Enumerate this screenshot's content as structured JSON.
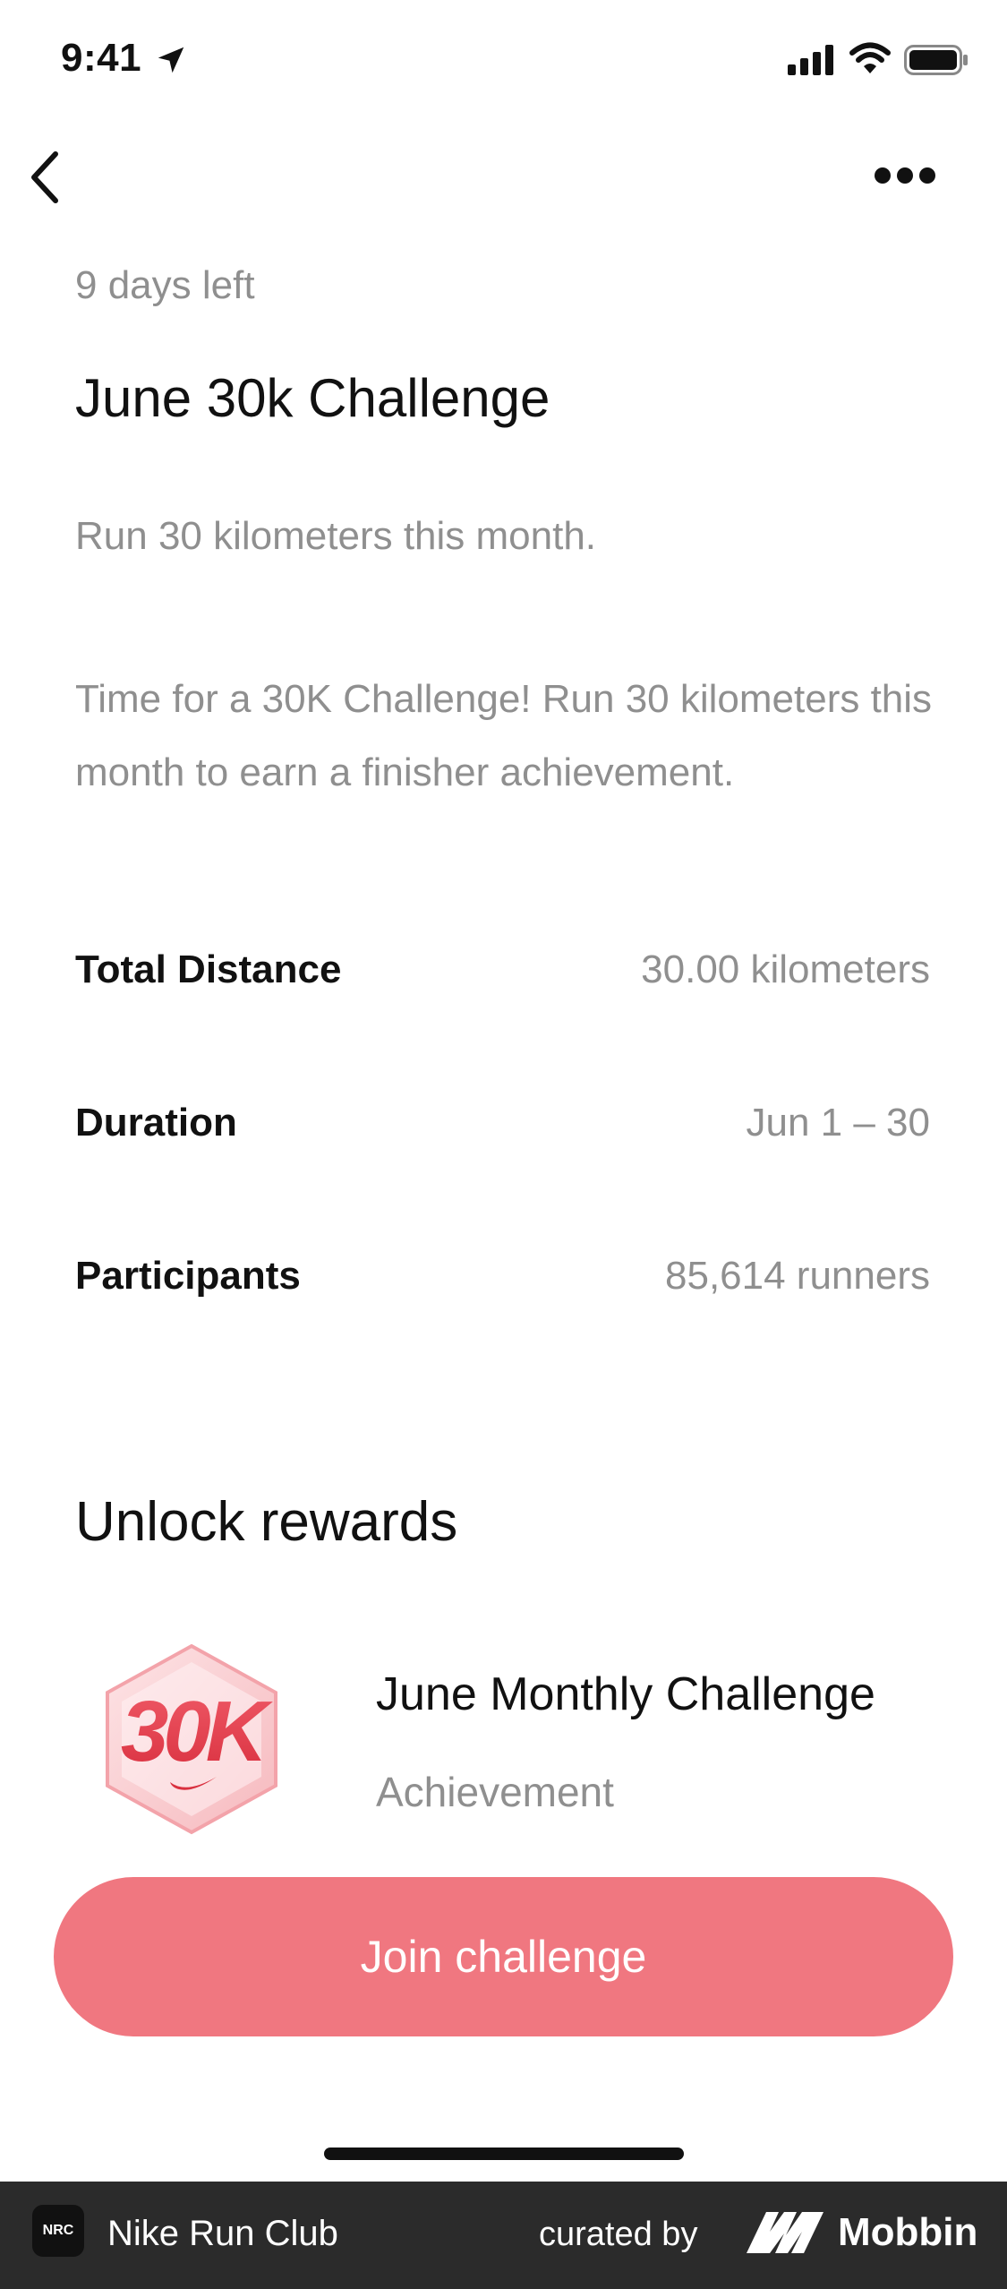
{
  "status_bar": {
    "time": "9:41"
  },
  "header": {
    "days_left": "9 days left",
    "title": "June 30k Challenge"
  },
  "intro": {
    "subtitle": "Run 30 kilometers this month.",
    "description": "Time for a 30K Challenge! Run 30 kilometers this month to earn a finisher achievement."
  },
  "details": [
    {
      "label": "Total Distance",
      "value": "30.00 kilometers"
    },
    {
      "label": "Duration",
      "value": "Jun 1 – 30"
    },
    {
      "label": "Participants",
      "value": "85,614 runners"
    }
  ],
  "rewards": {
    "section_title": "Unlock rewards",
    "item": {
      "title": "June Monthly Challenge",
      "subtitle": "Achievement",
      "badge_text": "30K"
    }
  },
  "cta": {
    "label": "Join challenge"
  },
  "footer": {
    "app_name": "Nike Run Club",
    "app_icon_text": "NRC",
    "curated_by": "curated by",
    "brand": "Mobbin"
  },
  "colors": {
    "accent": "#f07780",
    "muted_text": "#8f8f8f",
    "footer_bg": "#2b2b2b"
  },
  "icons": [
    "location-arrow-icon",
    "signal-icon",
    "wifi-icon",
    "battery-icon",
    "chevron-left-icon",
    "more-horizontal-icon",
    "mobbin-logo-icon"
  ]
}
